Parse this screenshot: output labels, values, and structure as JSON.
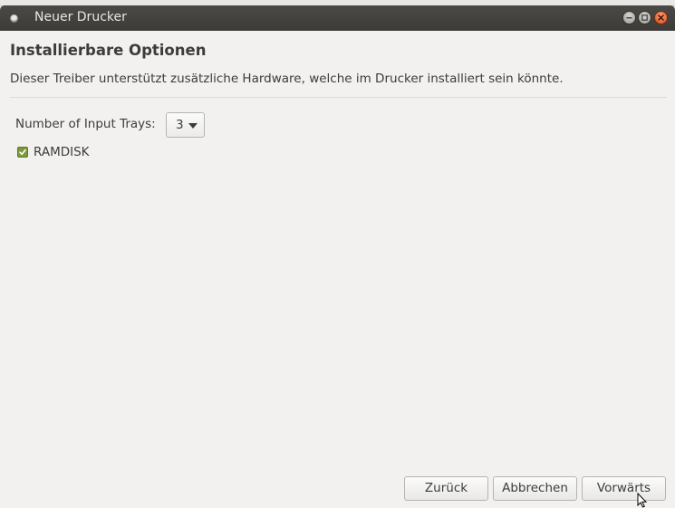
{
  "window": {
    "title": "Neuer Drucker",
    "menu_icon": "window-menu-icon",
    "controls": {
      "minimize": "minimize-icon",
      "maximize": "maximize-icon",
      "close": "close-icon"
    }
  },
  "page": {
    "heading": "Installierbare Optionen",
    "description": "Dieser Treiber unterstützt zusätzliche Hardware, welche im Drucker installiert sein könnte."
  },
  "options": {
    "input_trays": {
      "label": "Number of Input Trays:",
      "value": "3"
    },
    "ramdisk": {
      "label": "RAMDISK",
      "checked": true
    }
  },
  "buttons": {
    "back": "Zurück",
    "cancel": "Abbrechen",
    "forward": "Vorwärts"
  },
  "colors": {
    "titlebar": "#3c3b37",
    "close_button": "#df4a16",
    "checkbox": "#7a9a3a"
  }
}
